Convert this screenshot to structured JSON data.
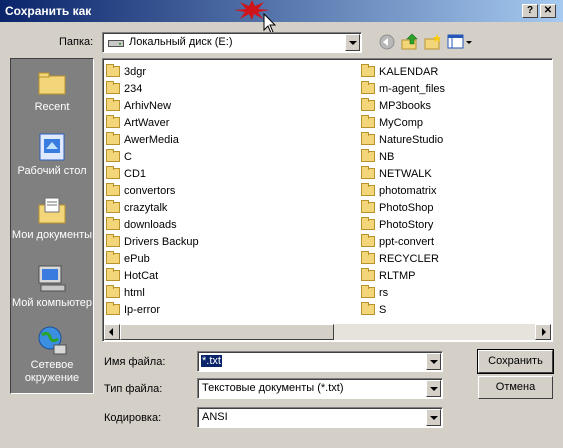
{
  "window": {
    "title": "Сохранить как",
    "help_label": "?",
    "close_label": "✕"
  },
  "toolbar": {
    "look_in_label": "Папка:",
    "look_in_value": "Локальный диск (E:)",
    "back_icon": "back-arrow-icon",
    "up_icon": "up-folder-icon",
    "new_folder_icon": "new-folder-icon",
    "views_icon": "views-menu-icon"
  },
  "places": [
    {
      "label": "Recent",
      "icon": "recent-icon"
    },
    {
      "label": "Рабочий стол",
      "icon": "desktop-icon"
    },
    {
      "label": "Мои документы",
      "icon": "my-documents-icon"
    },
    {
      "label": "Мой компьютер",
      "icon": "my-computer-icon"
    },
    {
      "label": "Сетевое окружение",
      "icon": "network-icon"
    }
  ],
  "files": {
    "col1": [
      "3dgr",
      "234",
      "ArhivNew",
      "ArtWaver",
      "AwerMedia",
      "C",
      "CD1",
      "convertors",
      "crazytalk",
      "downloads",
      "Drivers Backup",
      "ePub",
      "HotCat",
      "html",
      "Ip-error"
    ],
    "col2": [
      "KALENDAR",
      "m-agent_files",
      "MP3books",
      "MyComp",
      "NatureStudio",
      "NB",
      "NETWALK",
      "photomatrix",
      "PhotoShop",
      "PhotoStory",
      "ppt-convert",
      "RECYCLER",
      "RLTMP",
      "rs",
      "S"
    ]
  },
  "form": {
    "filename_label": "Имя файла:",
    "filename_value": "*.txt",
    "filetype_label": "Тип файла:",
    "filetype_value": "Текстовые документы (*.txt)",
    "encoding_label": "Кодировка:",
    "encoding_value": "ANSI"
  },
  "buttons": {
    "save": "Сохранить",
    "cancel": "Отмена"
  },
  "colors": {
    "title_start": "#0a246a",
    "title_end": "#a6caf0",
    "face": "#d4d0c8",
    "places_bg": "#808080",
    "folder": "#f4d67a"
  }
}
